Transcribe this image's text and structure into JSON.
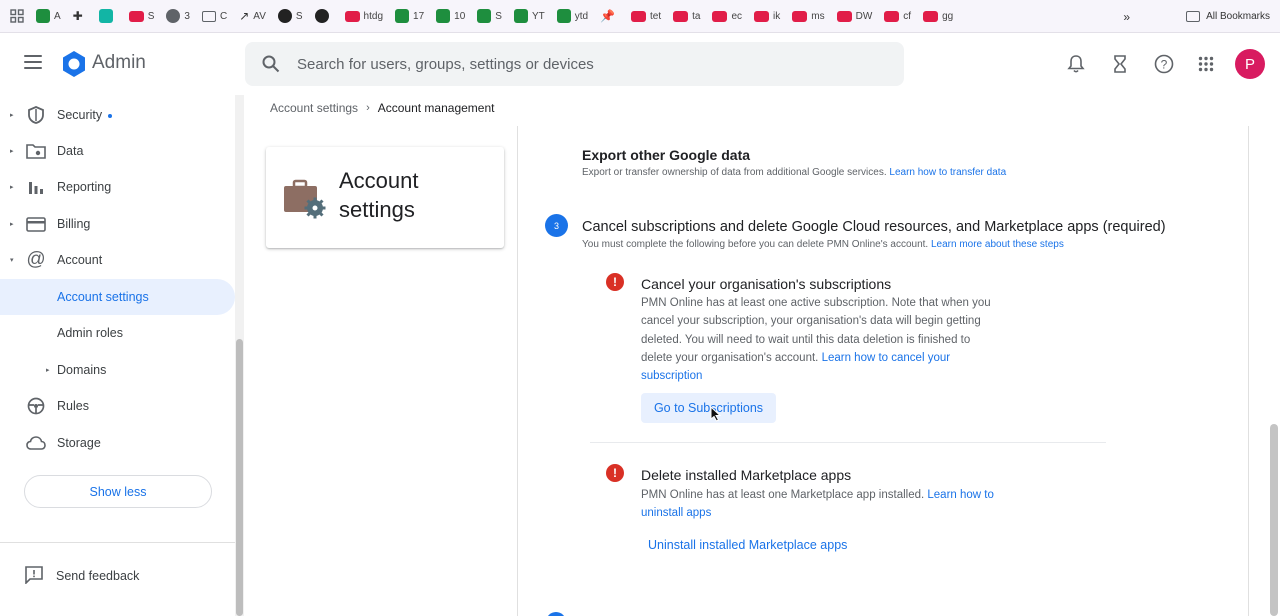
{
  "bookmarks": {
    "items": [
      {
        "label": "",
        "icon": "apps-grid-icon"
      },
      {
        "label": "A",
        "icon": "sheets-icon"
      },
      {
        "label": "",
        "icon": "extension-icon"
      },
      {
        "label": "",
        "icon": "teal-app-icon"
      },
      {
        "label": "S",
        "icon": "youtube-icon"
      },
      {
        "label": "3",
        "icon": "globe-icon"
      },
      {
        "label": "C",
        "icon": "folder-icon"
      },
      {
        "label": "AV",
        "icon": "trend-icon"
      },
      {
        "label": "S",
        "icon": "globe-icon"
      },
      {
        "label": "",
        "icon": "github-icon"
      },
      {
        "label": "htdg",
        "icon": "youtube-icon"
      },
      {
        "label": "17",
        "icon": "sheets-icon"
      },
      {
        "label": "10",
        "icon": "sheets-icon"
      },
      {
        "label": "S",
        "icon": "sheets-icon"
      },
      {
        "label": "YT",
        "icon": "sheets-icon"
      },
      {
        "label": "ytd",
        "icon": "sheets-icon"
      },
      {
        "label": "",
        "icon": "pin-icon"
      },
      {
        "label": "tet",
        "icon": "youtube-icon"
      },
      {
        "label": "ta",
        "icon": "youtube-icon"
      },
      {
        "label": "ec",
        "icon": "youtube-icon"
      },
      {
        "label": "ik",
        "icon": "youtube-icon"
      },
      {
        "label": "ms",
        "icon": "youtube-icon"
      },
      {
        "label": "DW",
        "icon": "youtube-icon"
      },
      {
        "label": "cf",
        "icon": "youtube-icon"
      },
      {
        "label": "gg",
        "icon": "youtube-icon"
      }
    ],
    "overflow": "»",
    "all_bookmarks": "All Bookmarks"
  },
  "header": {
    "brand": "Admin",
    "search_placeholder": "Search for users, groups, settings or devices",
    "avatar_letter": "P"
  },
  "sidebar": {
    "items": [
      {
        "label": "Security",
        "icon": "shield-icon",
        "caret": "▸",
        "dot": true
      },
      {
        "label": "Data",
        "icon": "data-folder-icon",
        "caret": "▸"
      },
      {
        "label": "Reporting",
        "icon": "bar-chart-icon",
        "caret": "▸"
      },
      {
        "label": "Billing",
        "icon": "credit-card-icon",
        "caret": "▸"
      },
      {
        "label": "Account",
        "icon": "at-sign-icon",
        "caret": "▾"
      },
      {
        "label": "Account settings",
        "active": true
      },
      {
        "label": "Admin roles"
      },
      {
        "label": "Domains",
        "caret": "▸"
      },
      {
        "label": "Rules",
        "icon": "steering-icon"
      },
      {
        "label": "Storage",
        "icon": "cloud-icon"
      }
    ],
    "show_less": "Show less",
    "feedback": "Send feedback"
  },
  "breadcrumb": {
    "parent": "Account settings",
    "separator": "›",
    "current": "Account management"
  },
  "card": {
    "title": "Account settings"
  },
  "content": {
    "export": {
      "title": "Export other Google data",
      "desc": "Export or transfer ownership of data from additional Google services.",
      "link": "Learn how to transfer data"
    },
    "step3": {
      "number": "3",
      "title": "Cancel subscriptions and delete Google Cloud resources, and Marketplace apps (required)",
      "desc": "You must complete the following before you can delete PMN Online's account.",
      "link": "Learn more about these steps"
    },
    "subscriptions": {
      "title": "Cancel your organisation's subscriptions",
      "line1": "PMN Online has at least one active subscription. Note that when you",
      "line2": "cancel your subscription, your organisation's data will begin getting",
      "line3": "deleted. You will need to wait until this data deletion is finished to",
      "line4": "delete your organisation's account.",
      "link1": "Learn how to cancel your",
      "link2": "subscription",
      "button": "Go to Subscriptions"
    },
    "marketplace": {
      "title": "Delete installed Marketplace apps",
      "line1": "PMN Online has at least one Marketplace app installed.",
      "link1": "Learn how to",
      "link2": "uninstall apps",
      "button": "Uninstall installed Marketplace apps"
    }
  },
  "colors": {
    "accent": "#1a73e8",
    "error": "#d93025",
    "avatar": "#d81b60"
  }
}
